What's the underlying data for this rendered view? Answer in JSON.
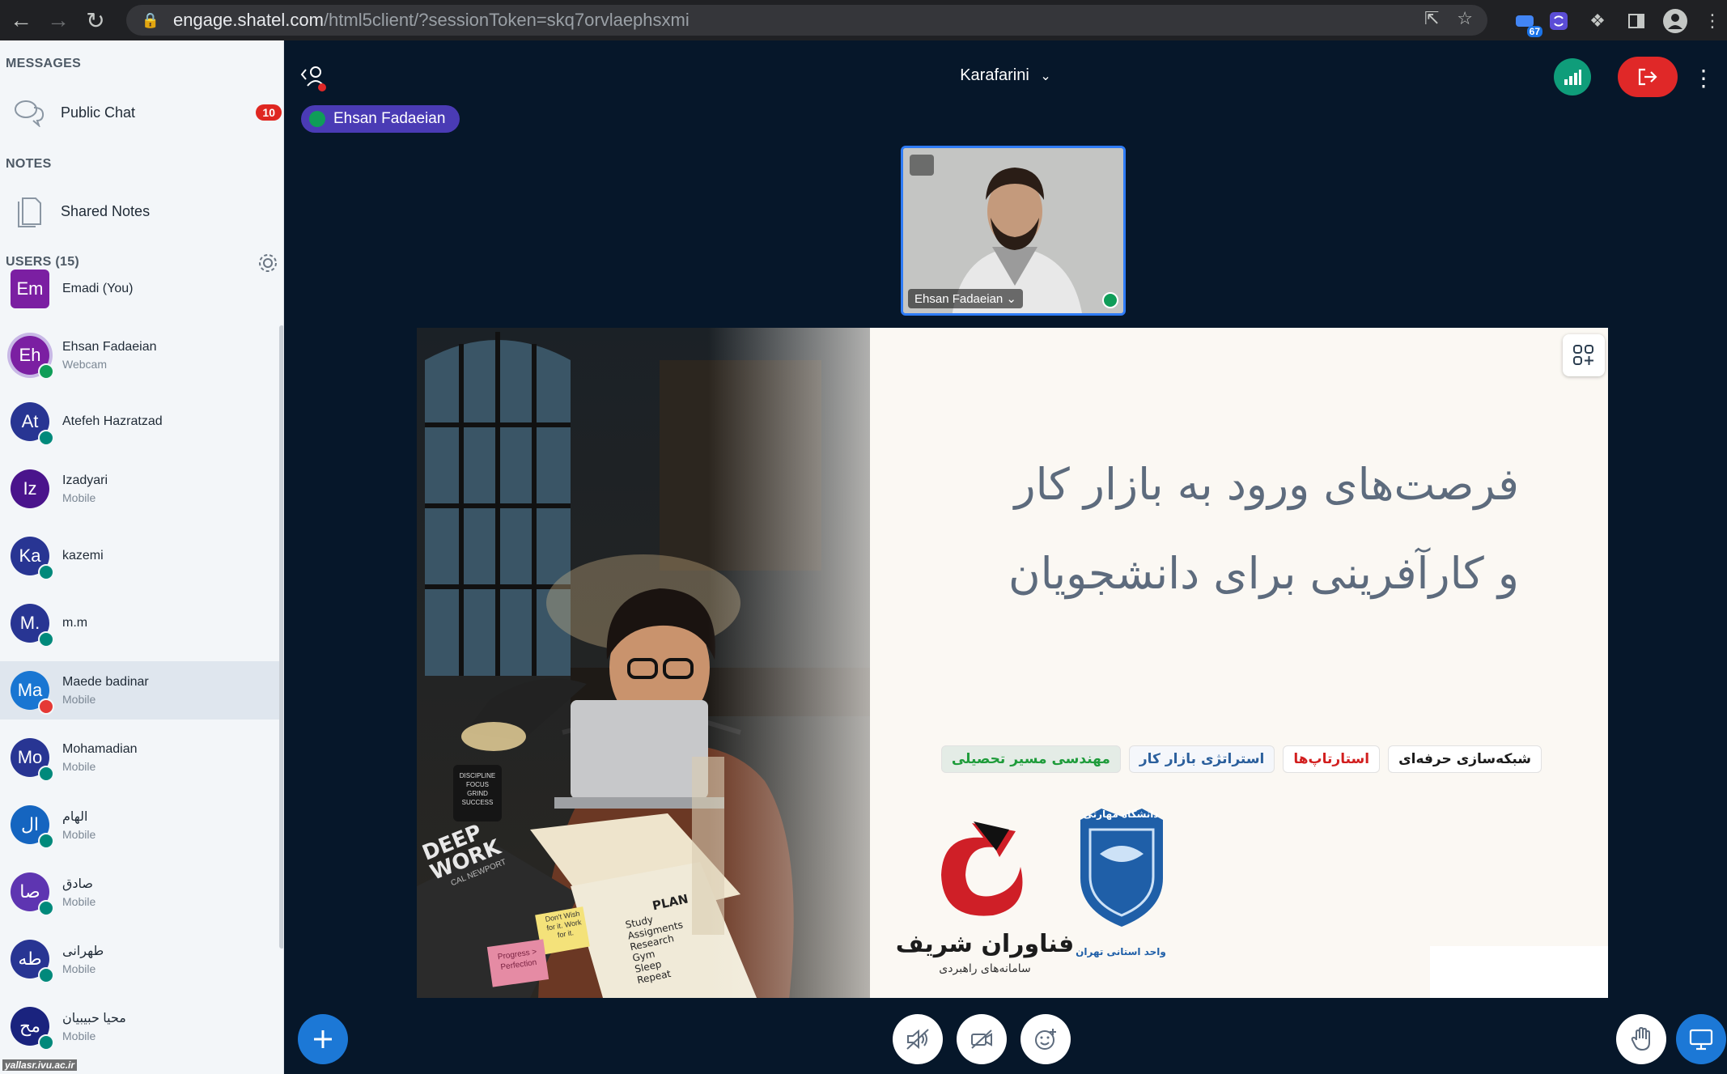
{
  "browser": {
    "url_host": "engage.shatel.com",
    "url_path": "/html5client/?sessionToken=skq7orvlaephsxmi",
    "extension_badge": "67"
  },
  "sidebar": {
    "messages_title": "MESSAGES",
    "public_chat_label": "Public Chat",
    "public_chat_unread": "10",
    "notes_title": "NOTES",
    "shared_notes_label": "Shared Notes",
    "users_title": "USERS (15)",
    "users": [
      {
        "initials": "Em",
        "name": "Emadi (You)",
        "sub": "",
        "color": "#7b1fa2",
        "status": "none"
      },
      {
        "initials": "Eh",
        "name": "Ehsan Fadaeian",
        "sub": "Webcam",
        "color": "#7b1fa2",
        "status": "talking"
      },
      {
        "initials": "At",
        "name": "Atefeh Hazratzad",
        "sub": "",
        "color": "#283593",
        "status": "listen"
      },
      {
        "initials": "Iz",
        "name": "Izadyari",
        "sub": "Mobile",
        "color": "#4a148c",
        "status": "none"
      },
      {
        "initials": "Ka",
        "name": "kazemi",
        "sub": "",
        "color": "#283593",
        "status": "listen"
      },
      {
        "initials": "M.",
        "name": "m.m",
        "sub": "",
        "color": "#283593",
        "status": "listen"
      },
      {
        "initials": "Ma",
        "name": "Maede badinar",
        "sub": "Mobile",
        "color": "#1976d2",
        "status": "muted"
      },
      {
        "initials": "Mo",
        "name": "Mohamadian",
        "sub": "Mobile",
        "color": "#283593",
        "status": "listen"
      },
      {
        "initials": "ال",
        "name": "الهام",
        "sub": "Mobile",
        "color": "#1565c0",
        "status": "listen"
      },
      {
        "initials": "صا",
        "name": "صادق",
        "sub": "Mobile",
        "color": "#5e35b1",
        "status": "listen"
      },
      {
        "initials": "طه",
        "name": "طهرانی",
        "sub": "Mobile",
        "color": "#283593",
        "status": "listen"
      },
      {
        "initials": "مح",
        "name": "محیا حبیبیان",
        "sub": "Mobile",
        "color": "#1a237e",
        "status": "listen"
      }
    ],
    "watermark": "yallasr.ivu.ac.ir"
  },
  "main": {
    "meeting_title": "Karafarini",
    "talker_name": "Ehsan Fadaeian",
    "webcam_name": "Ehsan Fadaeian",
    "slide": {
      "title_line1": "فرصت‌های ورود به بازار کار",
      "title_line2": "و کارآفرینی برای دانشجویان",
      "tags": [
        "مهندسی مسیر تحصیلی",
        "استراتژی بازار کار",
        "استارتاپ‌ها",
        "شبکه‌سازی حرفه‌ای"
      ],
      "logo1_name": "فناوران شریف",
      "logo1_sub": "سامانه‌های راهبردی",
      "logo2_name": "دانشگاه مهارتی",
      "logo2_sub": "واحد استانی تهران",
      "book_title": "DEEP WORK",
      "book_author": "CAL NEWPORT",
      "mug_text": "DISCIPLINE FOCUS GRIND SUCCESS",
      "plan_title": "PLAN",
      "plan_items": [
        "Study",
        "Assigments",
        "Research",
        "Gym",
        "Sleep",
        "Repeat"
      ],
      "sticky1": "Don't Wish for it. Work for it.",
      "sticky2": "Progress > Perfection"
    }
  },
  "colors": {
    "accent_blue": "#1c78d6",
    "leave_red": "#e02828",
    "connection_green": "#0f9d7a",
    "talker_purple": "#4a3bb5"
  }
}
